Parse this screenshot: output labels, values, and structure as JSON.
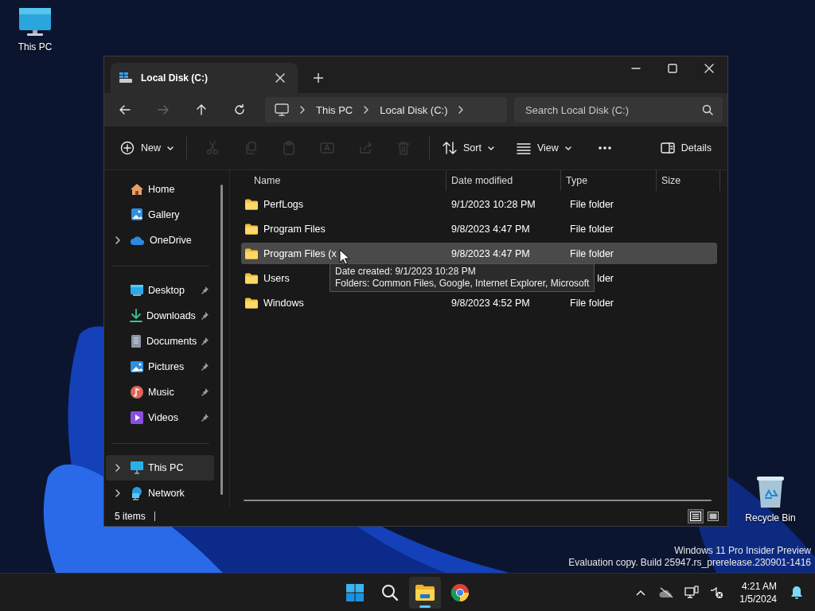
{
  "desktop_icons": [
    {
      "kind": "computer",
      "label": "This PC"
    },
    {
      "kind": "recycle_bin",
      "label": "Recycle Bin"
    }
  ],
  "window": {
    "tabs": [
      {
        "title": "Local Disk (C:)",
        "selected": true
      }
    ],
    "nav_buttons": [
      {
        "kind": "back",
        "disabled": false
      },
      {
        "kind": "forward",
        "disabled": true
      },
      {
        "kind": "up",
        "disabled": false
      },
      {
        "kind": "refresh",
        "disabled": false
      }
    ],
    "breadcrumb": [
      "This PC",
      "Local Disk (C:)"
    ],
    "search": {
      "placeholder": "Search Local Disk (C:)"
    },
    "toolbar": [
      {
        "kind": "new",
        "label": "New",
        "disabled": false
      },
      {
        "kind": "cut",
        "disabled": true
      },
      {
        "kind": "copy",
        "disabled": true
      },
      {
        "kind": "paste",
        "disabled": true
      },
      {
        "kind": "rename",
        "disabled": true
      },
      {
        "kind": "share",
        "disabled": true
      },
      {
        "kind": "delete",
        "disabled": true
      },
      {
        "kind": "sort",
        "label": "Sort",
        "disabled": false
      },
      {
        "kind": "view",
        "label": "View",
        "disabled": false
      },
      {
        "kind": "more",
        "disabled": false
      },
      {
        "kind": "details",
        "label": "Details",
        "disabled": false
      }
    ],
    "nav_groups": [
      [
        {
          "kind": "home",
          "label": "Home",
          "expandable": false,
          "pinned": false,
          "selected": false
        },
        {
          "kind": "gallery",
          "label": "Gallery",
          "expandable": false,
          "pinned": false,
          "selected": false
        },
        {
          "kind": "cloud",
          "label": "OneDrive",
          "expandable": true,
          "pinned": false,
          "selected": false
        }
      ],
      [
        {
          "kind": "desktop",
          "label": "Desktop",
          "expandable": false,
          "pinned": true,
          "selected": false
        },
        {
          "kind": "download",
          "label": "Downloads",
          "expandable": false,
          "pinned": true,
          "selected": false
        },
        {
          "kind": "document",
          "label": "Documents",
          "expandable": false,
          "pinned": true,
          "selected": false
        },
        {
          "kind": "picture",
          "label": "Pictures",
          "expandable": false,
          "pinned": true,
          "selected": false
        },
        {
          "kind": "music",
          "label": "Music",
          "expandable": false,
          "pinned": true,
          "selected": false
        },
        {
          "kind": "video",
          "label": "Videos",
          "expandable": false,
          "pinned": true,
          "selected": false
        }
      ],
      [
        {
          "kind": "computer",
          "label": "This PC",
          "expandable": true,
          "pinned": false,
          "selected": true
        },
        {
          "kind": "network",
          "label": "Network",
          "expandable": true,
          "pinned": false,
          "selected": false
        }
      ]
    ],
    "columns": [
      "Name",
      "Date modified",
      "Type",
      "Size"
    ],
    "rows": [
      {
        "name": "PerfLogs",
        "date": "9/1/2023 10:28 PM",
        "type": "File folder",
        "hovered": false
      },
      {
        "name": "Program Files",
        "date": "9/8/2023 4:47 PM",
        "type": "File folder",
        "hovered": false
      },
      {
        "name": "Program Files (x",
        "date": "9/8/2023 4:47 PM",
        "type": "File folder",
        "hovered": true
      },
      {
        "name": "Users",
        "type": "lder",
        "hovered": false
      },
      {
        "name": "Windows",
        "date": "9/8/2023 4:52 PM",
        "type": "File folder",
        "hovered": false
      }
    ],
    "tooltip": [
      "Date created: 9/1/2023 10:28 PM",
      "Folders: Common Files, Google, Internet Explorer, Microsoft"
    ],
    "status": "5 items",
    "view_modes": [
      {
        "kind": "details",
        "selected": true
      },
      {
        "kind": "tiles",
        "selected": false
      }
    ]
  },
  "watermark": [
    "Windows 11 Pro Insider Preview",
    "Evaluation copy. Build 25947.rs_prerelease.230901-1416"
  ],
  "taskbar": {
    "apps": [
      {
        "kind": "start",
        "active": false
      },
      {
        "kind": "search",
        "active": false
      },
      {
        "kind": "explorer",
        "active": true
      },
      {
        "kind": "chrome",
        "active": false
      }
    ],
    "tray": [
      {
        "kind": "chevron"
      },
      {
        "kind": "cloud_off"
      },
      {
        "kind": "network"
      },
      {
        "kind": "volume_muted"
      }
    ],
    "time": "4:21 AM",
    "date": "1/5/2024"
  }
}
